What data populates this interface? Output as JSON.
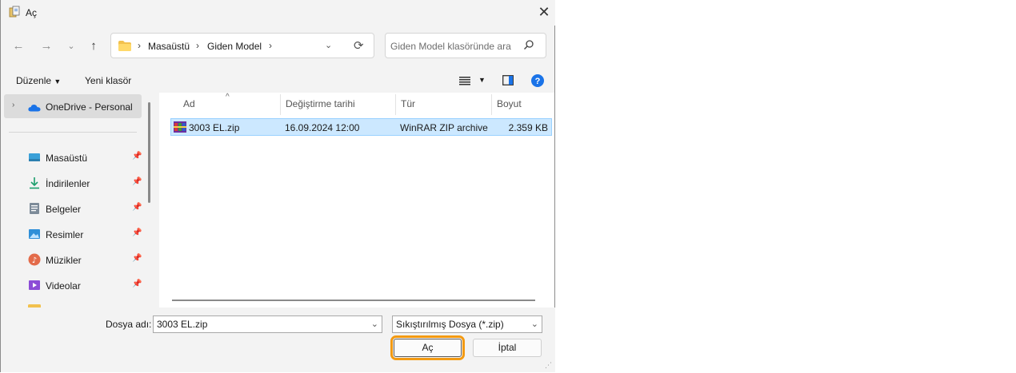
{
  "window": {
    "title": "Aç"
  },
  "nav": {
    "breadcrumb": [
      "Masaüstü",
      "Giden Model"
    ],
    "search_placeholder": "Giden Model klasöründe ara"
  },
  "toolbar": {
    "organize": "Düzenle",
    "new_folder": "Yeni klasör"
  },
  "sidebar": {
    "onedrive": "OneDrive - Personal",
    "items": [
      {
        "label": "Masaüstü",
        "icon": "desktop-icon"
      },
      {
        "label": "İndirilenler",
        "icon": "download-icon"
      },
      {
        "label": "Belgeler",
        "icon": "documents-icon"
      },
      {
        "label": "Resimler",
        "icon": "pictures-icon"
      },
      {
        "label": "Müzikler",
        "icon": "music-icon"
      },
      {
        "label": "Videolar",
        "icon": "videos-icon"
      }
    ]
  },
  "columns": {
    "name": "Ad",
    "modified": "Değiştirme tarihi",
    "type": "Tür",
    "size": "Boyut"
  },
  "files": [
    {
      "name": "3003 EL.zip",
      "modified": "16.09.2024 12:00",
      "type": "WinRAR ZIP archive",
      "size": "2.359 KB"
    }
  ],
  "bottom": {
    "filename_label": "Dosya adı:",
    "filename_value": "3003 EL.zip",
    "filter_value": "Sıkıştırılmış Dosya (*.zip)",
    "open_button": "Aç",
    "cancel_button": "İptal"
  },
  "colors": {
    "accent": "#f39a12",
    "selection": "#cce8ff",
    "help": "#1a73e8"
  }
}
